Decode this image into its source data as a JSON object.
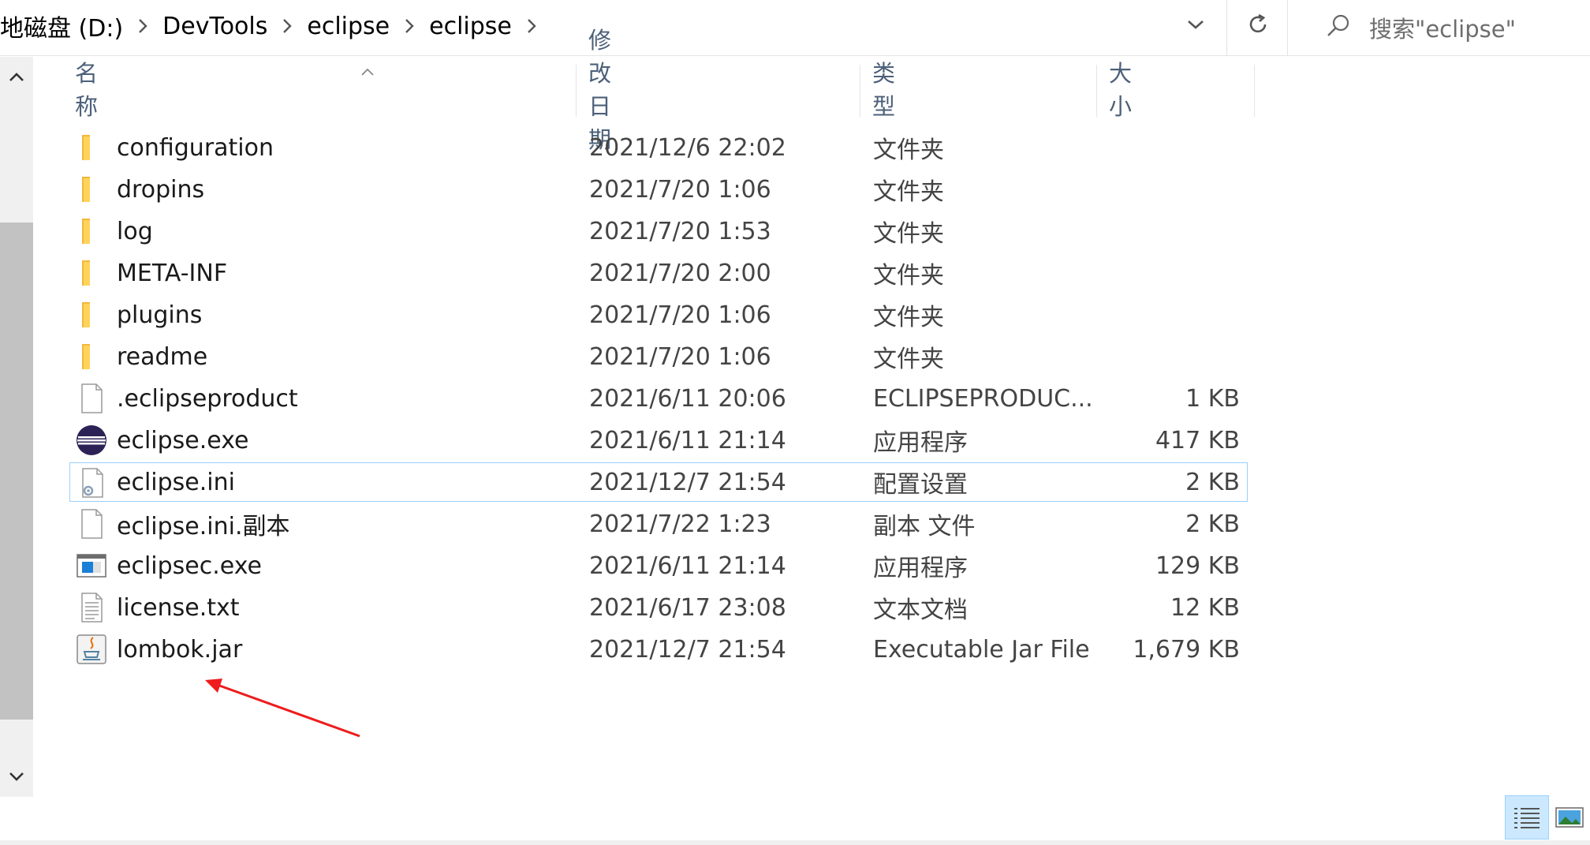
{
  "address": {
    "crumbs": [
      "地磁盘 (D:)",
      "DevTools",
      "eclipse",
      "eclipse"
    ],
    "search_placeholder": "搜索\"eclipse\""
  },
  "columns": {
    "name": "名称",
    "date": "修改日期",
    "type": "类型",
    "size": "大小"
  },
  "files": [
    {
      "name": "configuration",
      "date": "2021/12/6 22:02",
      "type": "文件夹",
      "size": "",
      "icon": "folder-icon"
    },
    {
      "name": "dropins",
      "date": "2021/7/20 1:06",
      "type": "文件夹",
      "size": "",
      "icon": "folder-icon"
    },
    {
      "name": "log",
      "date": "2021/7/20 1:53",
      "type": "文件夹",
      "size": "",
      "icon": "folder-icon"
    },
    {
      "name": "META-INF",
      "date": "2021/7/20 2:00",
      "type": "文件夹",
      "size": "",
      "icon": "folder-icon"
    },
    {
      "name": "plugins",
      "date": "2021/7/20 1:06",
      "type": "文件夹",
      "size": "",
      "icon": "folder-icon"
    },
    {
      "name": "readme",
      "date": "2021/7/20 1:06",
      "type": "文件夹",
      "size": "",
      "icon": "folder-icon"
    },
    {
      "name": ".eclipseproduct",
      "date": "2021/6/11 20:06",
      "type": "ECLIPSEPRODUC...",
      "size": "1 KB",
      "icon": "blank-file-icon"
    },
    {
      "name": "eclipse.exe",
      "date": "2021/6/11 21:14",
      "type": "应用程序",
      "size": "417 KB",
      "icon": "eclipse-logo-icon"
    },
    {
      "name": "eclipse.ini",
      "date": "2021/12/7 21:54",
      "type": "配置设置",
      "size": "2 KB",
      "icon": "config-file-icon"
    },
    {
      "name": "eclipse.ini.副本",
      "date": "2021/7/22 1:23",
      "type": "副本 文件",
      "size": "2 KB",
      "icon": "blank-file-icon"
    },
    {
      "name": "eclipsec.exe",
      "date": "2021/6/11 21:14",
      "type": "应用程序",
      "size": "129 KB",
      "icon": "console-app-icon"
    },
    {
      "name": "license.txt",
      "date": "2021/6/17 23:08",
      "type": "文本文档",
      "size": "12 KB",
      "icon": "text-file-icon"
    },
    {
      "name": "lombok.jar",
      "date": "2021/12/7 21:54",
      "type": "Executable Jar File",
      "size": "1,679 KB",
      "icon": "java-jar-icon"
    }
  ],
  "colors": {
    "header_text": "#4c607a",
    "selection_border": "#99d1ff",
    "annotation_arrow": "#ee1c1c",
    "folder": "#ffc83d"
  }
}
